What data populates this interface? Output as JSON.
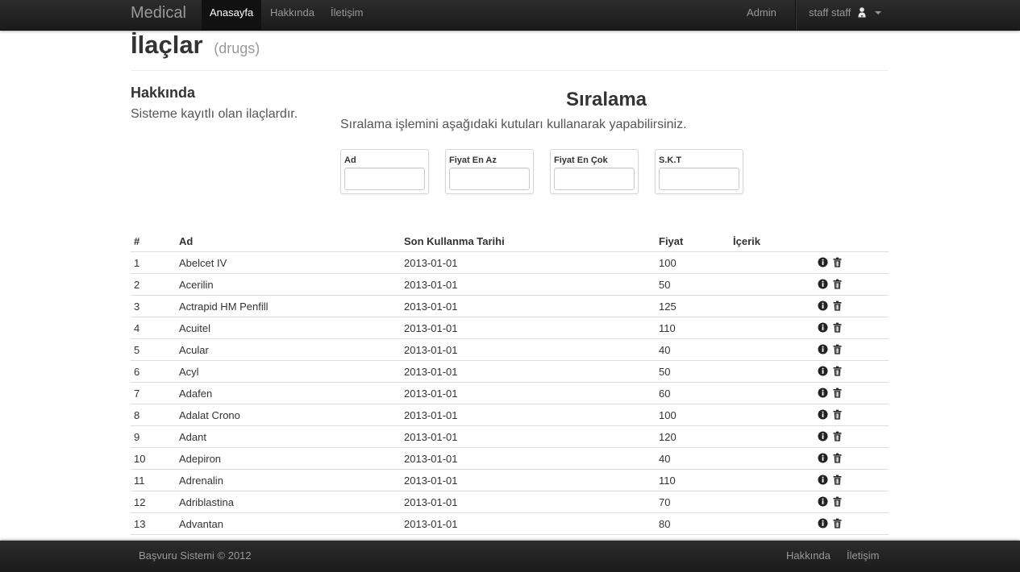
{
  "navbar": {
    "brand": "Medical",
    "links": [
      {
        "label": "Anasayfa",
        "active": true
      },
      {
        "label": "Hakkında",
        "active": false
      },
      {
        "label": "İletişim",
        "active": false
      }
    ],
    "admin": "Admin",
    "user": "staff staff",
    "user_icon": "user-icon"
  },
  "header": {
    "title": "İlaçlar",
    "subtitle": "(drugs)"
  },
  "about": {
    "title": "Hakkında",
    "text": "Sisteme kayıtlı olan ilaçlardır."
  },
  "sort": {
    "title": "Sıralama",
    "description": "Sıralama işlemini aşağıdaki kutuları kullanarak yapabilirsiniz.",
    "filters": [
      {
        "label": "Ad",
        "value": ""
      },
      {
        "label": "Fiyat En Az",
        "value": ""
      },
      {
        "label": "Fiyat En Çok",
        "value": ""
      },
      {
        "label": "S.K.T",
        "value": ""
      }
    ]
  },
  "table": {
    "columns": [
      "#",
      "Ad",
      "Son Kullanma Tarihi",
      "Fiyat",
      "İçerik"
    ],
    "rows": [
      {
        "id": "1",
        "name": "Abelcet IV",
        "expiry": "2013-01-01",
        "price": "100",
        "content": ""
      },
      {
        "id": "2",
        "name": "Acerilin",
        "expiry": "2013-01-01",
        "price": "50",
        "content": ""
      },
      {
        "id": "3",
        "name": "Actrapid HM Penfill",
        "expiry": "2013-01-01",
        "price": "125",
        "content": ""
      },
      {
        "id": "4",
        "name": "Acuitel",
        "expiry": "2013-01-01",
        "price": "110",
        "content": ""
      },
      {
        "id": "5",
        "name": "Acular",
        "expiry": "2013-01-01",
        "price": "40",
        "content": ""
      },
      {
        "id": "6",
        "name": "Acyl",
        "expiry": "2013-01-01",
        "price": "50",
        "content": ""
      },
      {
        "id": "7",
        "name": "Adafen",
        "expiry": "2013-01-01",
        "price": "60",
        "content": ""
      },
      {
        "id": "8",
        "name": "Adalat Crono",
        "expiry": "2013-01-01",
        "price": "100",
        "content": ""
      },
      {
        "id": "9",
        "name": "Adant",
        "expiry": "2013-01-01",
        "price": "120",
        "content": ""
      },
      {
        "id": "10",
        "name": "Adepiron",
        "expiry": "2013-01-01",
        "price": "40",
        "content": ""
      },
      {
        "id": "11",
        "name": "Adrenalin",
        "expiry": "2013-01-01",
        "price": "110",
        "content": ""
      },
      {
        "id": "12",
        "name": "Adriblastina",
        "expiry": "2013-01-01",
        "price": "70",
        "content": ""
      },
      {
        "id": "13",
        "name": "Advantan",
        "expiry": "2013-01-01",
        "price": "80",
        "content": ""
      },
      {
        "id": "",
        "name": "",
        "expiry": "",
        "price": "",
        "content": ""
      }
    ],
    "row_icons": [
      "info-icon",
      "trash-icon"
    ]
  },
  "footer": {
    "copyright": "Başvuru Sistemi © 2012",
    "links": [
      "Hakkında",
      "İletişim"
    ]
  }
}
